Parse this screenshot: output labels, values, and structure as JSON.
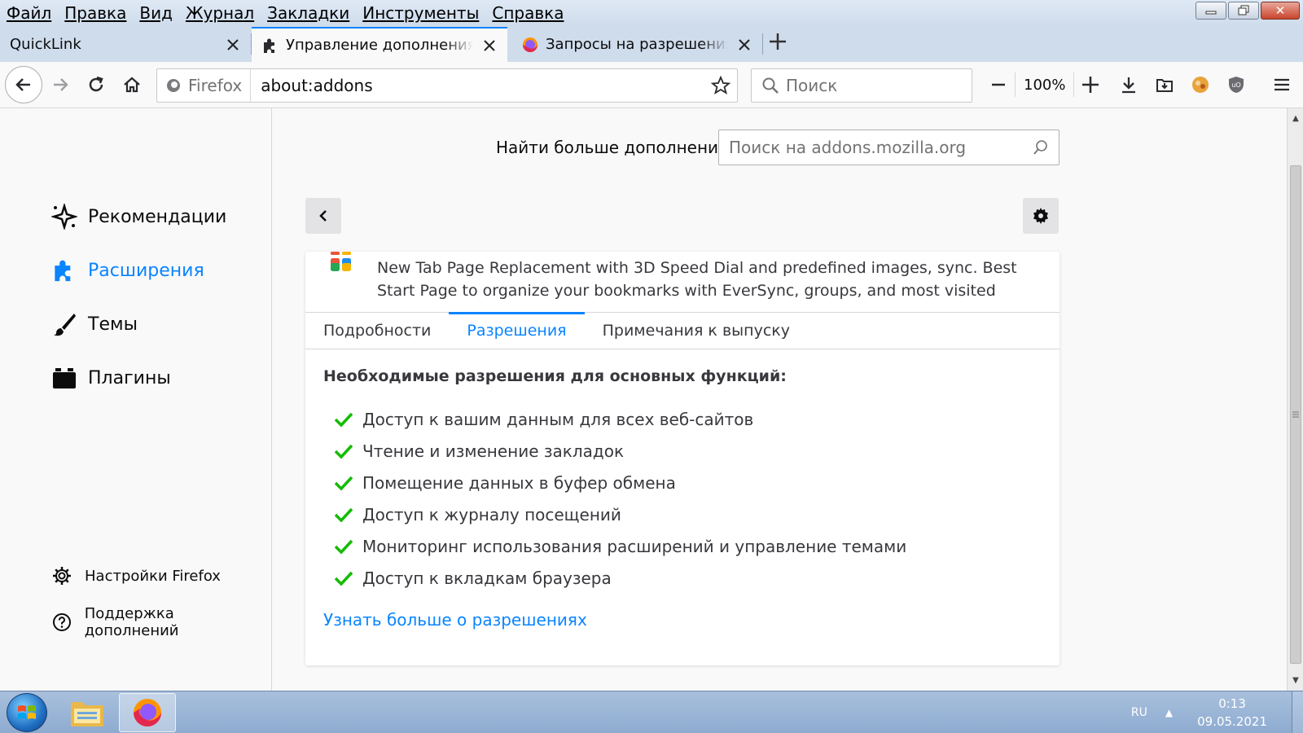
{
  "menubar": {
    "items": [
      "Файл",
      "Правка",
      "Вид",
      "Журнал",
      "Закладки",
      "Инструменты",
      "Справка"
    ]
  },
  "tabs": [
    {
      "label": "QuickLink",
      "active": false
    },
    {
      "label": "Управление дополнениями",
      "active": true
    },
    {
      "label": "Запросы на разрешения д",
      "active": false
    }
  ],
  "navbar": {
    "identity_label": "Firefox",
    "url": "about:addons",
    "search_placeholder": "Поиск",
    "zoom": "100%"
  },
  "sidebar": {
    "categories": [
      {
        "label": "Рекомендации",
        "icon": "sparkle-icon",
        "selected": false
      },
      {
        "label": "Расширения",
        "icon": "puzzle-icon",
        "selected": true
      },
      {
        "label": "Темы",
        "icon": "brush-icon",
        "selected": false
      },
      {
        "label": "Плагины",
        "icon": "plugin-icon",
        "selected": false
      }
    ],
    "footer": [
      {
        "label": "Настройки Firefox",
        "icon": "gear-icon"
      },
      {
        "label": "Поддержка дополнений",
        "icon": "help-icon"
      }
    ]
  },
  "main": {
    "find_more_label": "Найти больше дополнений",
    "amo_search_placeholder": "Поиск на addons.mozilla.org",
    "addon": {
      "description": "New Tab Page Replacement with 3D Speed Dial and predefined images, sync. Best Start Page to organize your bookmarks with EverSync, groups, and most visited"
    },
    "tabs": [
      {
        "label": "Подробности",
        "active": false
      },
      {
        "label": "Разрешения",
        "active": true
      },
      {
        "label": "Примечания к выпуску",
        "active": false
      }
    ],
    "permissions_title": "Необходимые разрешения для основных функций:",
    "permissions": [
      "Доступ к вашим данным для всех веб-сайтов",
      "Чтение и изменение закладок",
      "Помещение данных в буфер обмена",
      "Доступ к журналу посещений",
      "Мониторинг использования расширений и управление темами",
      "Доступ к вкладкам браузера"
    ],
    "learn_more": "Узнать больше о разрешениях"
  },
  "taskbar": {
    "language": "RU",
    "time": "0:13",
    "date": "09.05.2021"
  },
  "colors": {
    "accent": "#0a84ff",
    "check": "#12bc00",
    "text": "#0c0c0d"
  }
}
